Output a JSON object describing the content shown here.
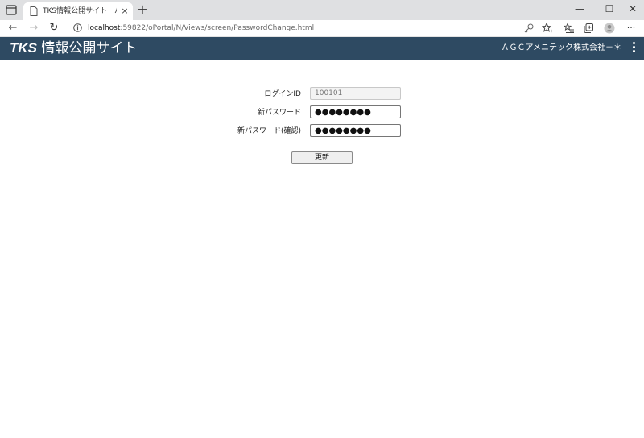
{
  "browser": {
    "tab_title": "TKS情報公開サイト　パスワード変更",
    "tab_close": "×",
    "new_tab": "+",
    "url_host": "localhost",
    "url_path": ":59822/oPortal/N/Views/screen/PasswordChange.html",
    "window_controls": {
      "minimize": "—",
      "maximize": "☐",
      "close": "✕"
    },
    "nav": {
      "back": "←",
      "forward": "→",
      "reload": "↻",
      "more": "···"
    }
  },
  "header": {
    "brand": "TKS",
    "title": "情報公開サイト",
    "company": "ＡＧＣアメニテック株式会社－＊",
    "accent_color": "#2e4a62"
  },
  "form": {
    "login_id_label": "ログインID",
    "login_id_value": "100101",
    "new_password_label": "新パスワード",
    "new_password_value": "●●●●●●●●",
    "confirm_password_label": "新パスワード(確認)",
    "confirm_password_value": "●●●●●●●●",
    "update_button": "更新"
  }
}
